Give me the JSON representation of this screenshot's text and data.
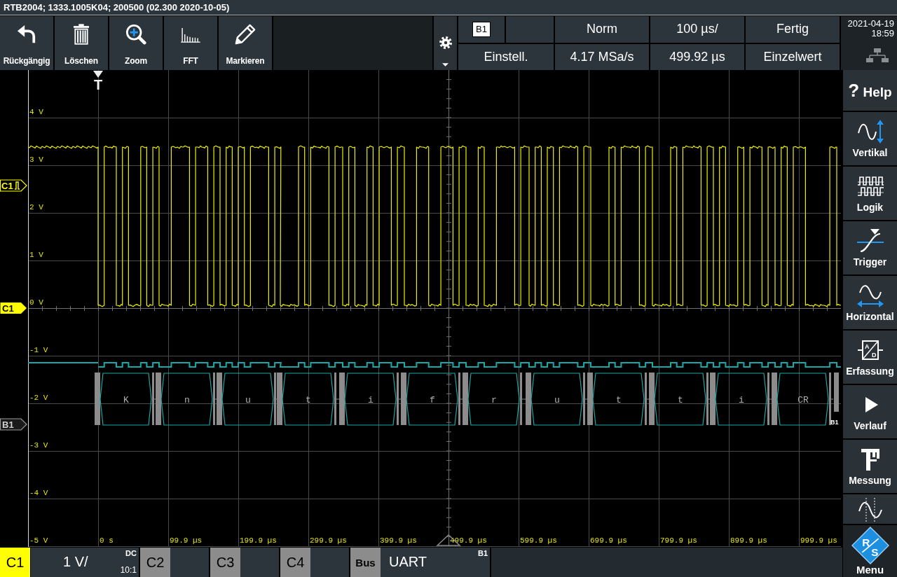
{
  "title_bar": {
    "title": "RTB2004; 1333.1005K04; 200500 (02.300 2020-10-05)"
  },
  "toolbar": {
    "buttons": [
      {
        "kind": "undo",
        "label": "Rückgängig"
      },
      {
        "kind": "delete",
        "label": "Löschen"
      },
      {
        "kind": "zoom",
        "label": "Zoom"
      },
      {
        "kind": "fft",
        "label": "FFT"
      },
      {
        "kind": "mark",
        "label": "Markieren"
      }
    ]
  },
  "status_panel": {
    "bus_badge": "B1",
    "trigger_mode": "Norm",
    "time_scale": "100 µs/",
    "acquisition_state": "Fertig",
    "setup": "Einstell.",
    "sample_rate": "4.17 MSa/s",
    "position": "499.92 µs",
    "run_mode": "Einzelwert"
  },
  "clock": {
    "date": "2021-04-19",
    "time": "18:59"
  },
  "scope": {
    "y_labels": [
      "4 V",
      "3 V",
      "2 V",
      "1 V",
      "0 V",
      "-1 V",
      "-2 V",
      "-3 V",
      "-4 V",
      "-5 V"
    ],
    "x_labels": [
      "0 s",
      "99.9 µs",
      "199.9 µs",
      "299.9 µs",
      "399.9 µs",
      "499.9 µs",
      "599.9 µs",
      "699.9 µs",
      "799.9 µs",
      "899.9 µs",
      "999.9 µs"
    ],
    "trigger_label": "T",
    "markers": [
      {
        "kind": "trigger_level",
        "label": "C1"
      },
      {
        "kind": "channel",
        "label": "C1"
      },
      {
        "kind": "bus",
        "label": "B1"
      }
    ],
    "decode": {
      "frames": [
        "K",
        "n",
        "u",
        "t",
        "i",
        "f",
        "r",
        "u",
        "t",
        "t",
        "i",
        "CR"
      ],
      "bus_label": "B1"
    }
  },
  "bottom_bar": {
    "channels": [
      {
        "name": "C1",
        "active": true,
        "scale": "1 V/",
        "coupling": "DC",
        "probe": "10:1"
      },
      {
        "name": "C2",
        "active": false
      },
      {
        "name": "C3",
        "active": false
      },
      {
        "name": "C4",
        "active": false
      }
    ],
    "bus": {
      "name": "Bus",
      "protocol": "UART",
      "id": "B1"
    }
  },
  "sidebar": {
    "help": {
      "symbol": "?",
      "label": "Help"
    },
    "items": [
      {
        "kind": "vertical",
        "label": "Vertikal"
      },
      {
        "kind": "logic",
        "label": "Logik"
      },
      {
        "kind": "trigger",
        "label": "Trigger"
      },
      {
        "kind": "horizontal",
        "label": "Horizontal"
      },
      {
        "kind": "acquisition",
        "label": "Erfassung",
        "icon_letters": [
          "A",
          "D"
        ]
      },
      {
        "kind": "history",
        "label": "Verlauf"
      },
      {
        "kind": "measure",
        "label": "Messung"
      },
      {
        "kind": "cursor"
      }
    ],
    "menu": {
      "logo_letters": [
        "R",
        "S"
      ],
      "label": "Menu"
    }
  }
}
